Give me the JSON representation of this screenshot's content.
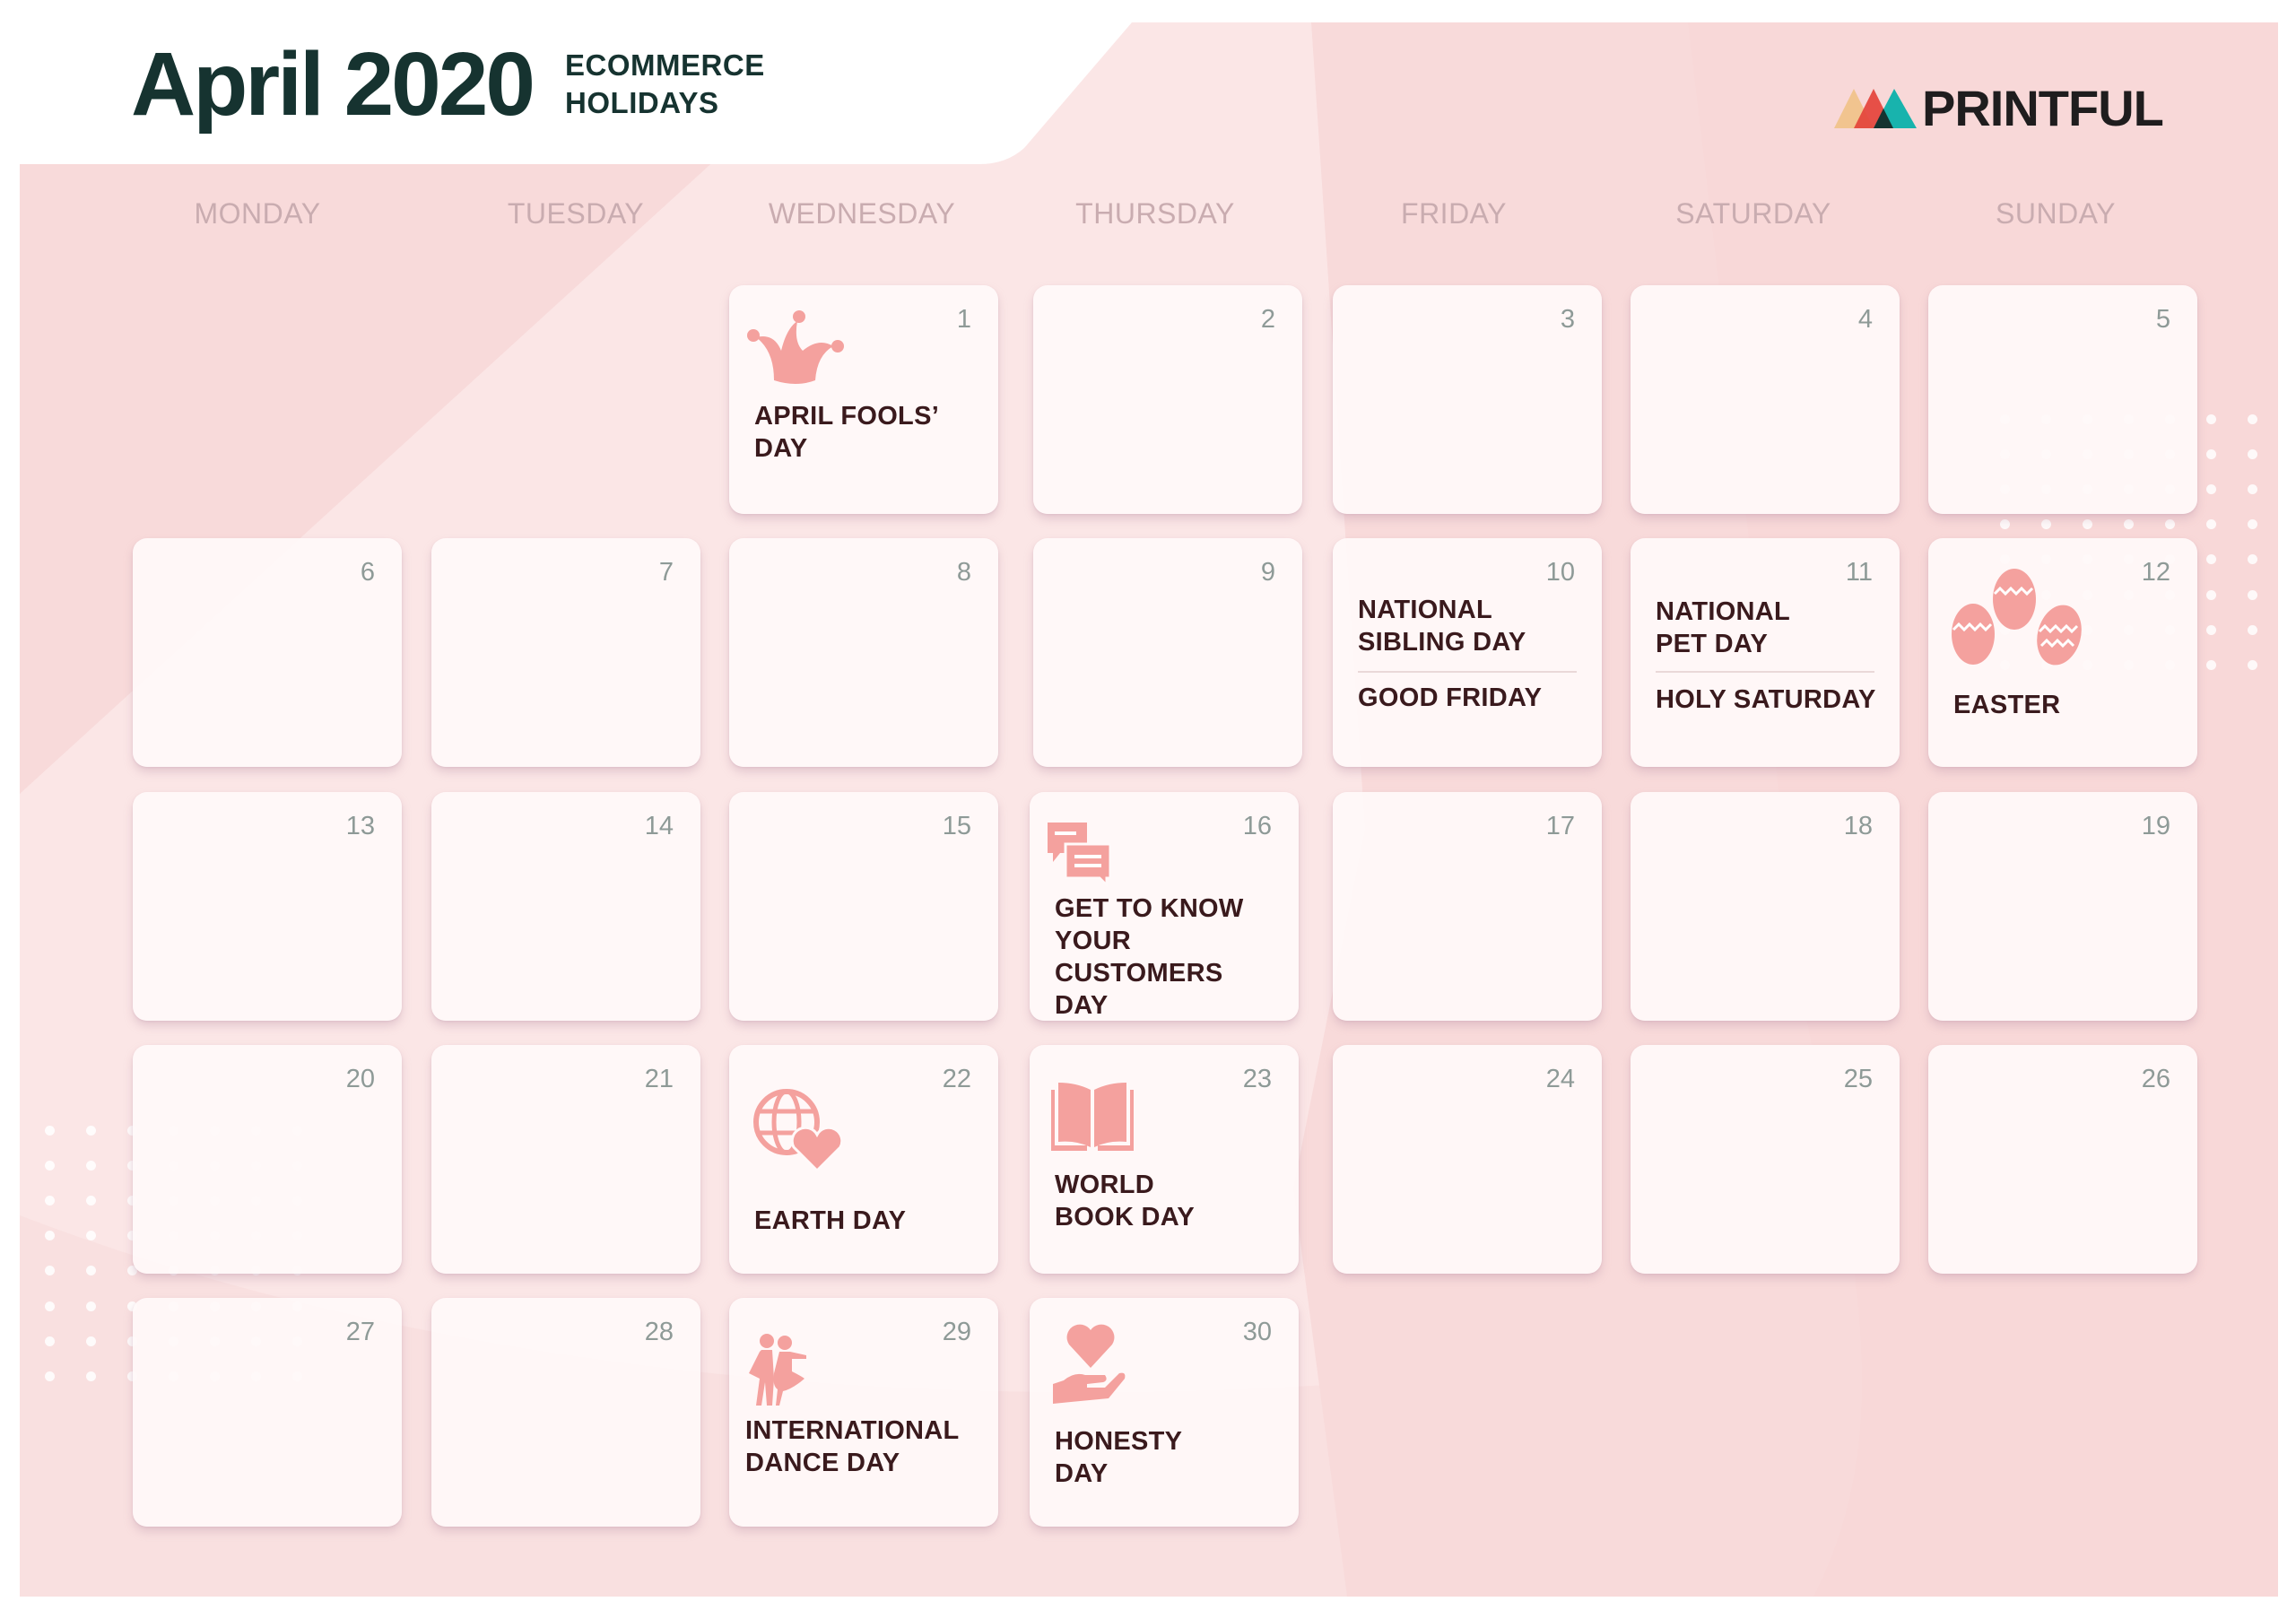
{
  "header": {
    "title": "April 2020",
    "subtitle_line1": "ECOMMERCE",
    "subtitle_line2": "HOLIDAYS",
    "brand": "PRINTFUL"
  },
  "colors": {
    "accent_icon": "#f4a19e",
    "title_text": "#163330",
    "holiday_text": "#3a1a1d",
    "day_number": "#8e9a97",
    "weekday_text": "#c9acb0",
    "background_pink": "#f8dada",
    "logo_triangles": [
      "#f1c48f",
      "#e4433b",
      "#18b3ad",
      "#163330"
    ]
  },
  "weekdays": [
    "MONDAY",
    "TUESDAY",
    "WEDNESDAY",
    "THURSDAY",
    "FRIDAY",
    "SATURDAY",
    "SUNDAY"
  ],
  "days": [
    {
      "day": "1",
      "holiday": "APRIL FOOLS’\nDAY",
      "icon": "jester-hat-icon"
    },
    {
      "day": "2"
    },
    {
      "day": "3"
    },
    {
      "day": "4"
    },
    {
      "day": "5"
    },
    {
      "day": "6"
    },
    {
      "day": "7"
    },
    {
      "day": "8"
    },
    {
      "day": "9"
    },
    {
      "day": "10",
      "holiday": "NATIONAL\nSIBLING DAY",
      "holiday2": "GOOD FRIDAY"
    },
    {
      "day": "11",
      "holiday": "NATIONAL\nPET DAY",
      "holiday2": "HOLY SATURDAY"
    },
    {
      "day": "12",
      "holiday": "EASTER",
      "icon": "easter-eggs-icon"
    },
    {
      "day": "13"
    },
    {
      "day": "14"
    },
    {
      "day": "15"
    },
    {
      "day": "16",
      "holiday": "GET TO KNOW\nYOUR CUSTOMERS\nDAY",
      "icon": "chat-bubbles-icon"
    },
    {
      "day": "17"
    },
    {
      "day": "18"
    },
    {
      "day": "19"
    },
    {
      "day": "20"
    },
    {
      "day": "21"
    },
    {
      "day": "22",
      "holiday": "EARTH DAY",
      "icon": "globe-heart-icon"
    },
    {
      "day": "23",
      "holiday": "WORLD\nBOOK DAY",
      "icon": "open-book-icon"
    },
    {
      "day": "24"
    },
    {
      "day": "25"
    },
    {
      "day": "26"
    },
    {
      "day": "27"
    },
    {
      "day": "28"
    },
    {
      "day": "29",
      "holiday": "INTERNATIONAL\nDANCE DAY",
      "icon": "dancing-couple-icon"
    },
    {
      "day": "30",
      "holiday": "HONESTY\nDAY",
      "icon": "hand-heart-icon"
    }
  ]
}
